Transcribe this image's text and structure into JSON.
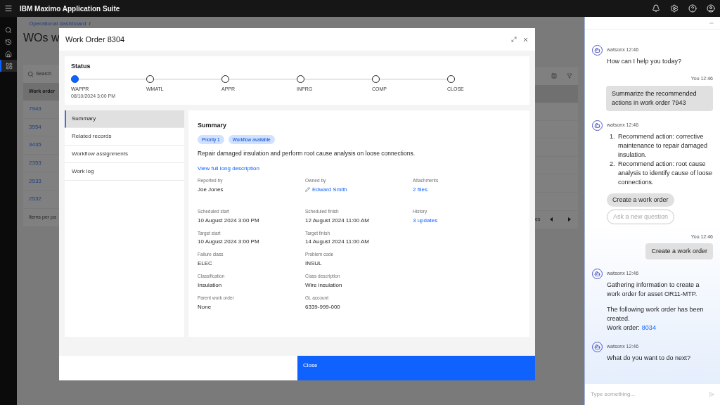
{
  "app_bar": {
    "title": "IBM Maximo Application Suite"
  },
  "side_rail": [
    {
      "selected": false
    },
    {
      "selected": false
    },
    {
      "selected": false
    },
    {
      "selected": true
    }
  ],
  "page": {
    "breadcrumb": "Operational dashboard",
    "breadcrumb_separator": "/",
    "title": "WOs w",
    "search_placeholder": "Search",
    "column_1": "Work order",
    "rows": [
      "7943",
      "3554",
      "3435",
      "2353",
      "2533",
      "2532"
    ],
    "footer_left": "Items per pa",
    "footer_right": "es"
  },
  "modal": {
    "title": "Work Order 8304",
    "status": {
      "title": "Status",
      "steps": [
        {
          "label": "WAPPR",
          "date": "08/10/2024 3:00 PM",
          "selected": true
        },
        {
          "label": "WMATL",
          "selected": false
        },
        {
          "label": "APPR",
          "selected": false
        },
        {
          "label": "INPRG",
          "selected": false
        },
        {
          "label": "COMP",
          "selected": false
        },
        {
          "label": "CLOSE",
          "selected": false
        }
      ]
    },
    "nav": [
      {
        "label": "Summary",
        "selected": true
      },
      {
        "label": "Related records",
        "selected": false
      },
      {
        "label": "Workflow assignments",
        "selected": false
      },
      {
        "label": "Work log",
        "selected": false
      }
    ],
    "summary": {
      "title": "Summary",
      "tags": [
        "Priority 1",
        "Workflow available"
      ],
      "description": "Repair damaged insulation and perform root cause analysis on loose connections.",
      "link": "View full long description",
      "rows": [
        [
          {
            "label": "Reported by",
            "value": "Joe Jones",
            "kind": "text"
          },
          {
            "label": "Owned by",
            "value": "Edward Smith",
            "kind": "owner"
          },
          {
            "label": "Attachments",
            "value": "2 files",
            "kind": "link"
          }
        ],
        [
          {
            "label": "Scheduled start",
            "value": "10 August 2024 3:00 PM",
            "kind": "text"
          },
          {
            "label": "Scheduled finish",
            "value": "12 August 2024 11:00 AM",
            "kind": "text"
          },
          {
            "label": "History",
            "value": "3 updates",
            "kind": "link"
          }
        ],
        [
          {
            "label": "Target start",
            "value": "10 August 2024 3:00 PM",
            "kind": "text"
          },
          {
            "label": "Target finish",
            "value": "14 August 2024 11:00 AM",
            "kind": "text"
          }
        ],
        [
          {
            "label": "Failure class",
            "value": "ELEC",
            "kind": "text"
          },
          {
            "label": "Problem code",
            "value": "INSUL",
            "kind": "text"
          }
        ],
        [
          {
            "label": "Classification",
            "value": "Insulation",
            "kind": "text"
          },
          {
            "label": "Class description",
            "value": "Wire insulation",
            "kind": "text"
          }
        ],
        [
          {
            "label": "Parent work order",
            "value": "None",
            "kind": "text"
          },
          {
            "label": "GL account",
            "value": "6339-999-000",
            "kind": "text"
          }
        ]
      ]
    },
    "close_button": "Close"
  },
  "chat": {
    "messages": [
      {
        "kind": "bot",
        "meta": "watsonx 12:46",
        "paragraphs": [
          {
            "text": "How can I help you today?"
          }
        ]
      },
      {
        "kind": "user",
        "meta": "You 12:46",
        "text": "Summarize the recommended actions in work order 7943"
      },
      {
        "kind": "bot",
        "meta": "watsonx 12:46",
        "list": [
          {
            "number": "1.",
            "text": "Recommend action: corrective maintenance to repair damaged insulation."
          },
          {
            "number": "2.",
            "text": "Recommend action: root cause analysis to identify cause of loose connections."
          }
        ],
        "chips": [
          {
            "label": "Create a work order",
            "disabled": false
          },
          {
            "label": "Ask a new question",
            "disabled": true
          }
        ]
      },
      {
        "kind": "user",
        "meta": "You 12:46",
        "text": "Create a work order"
      },
      {
        "kind": "bot",
        "meta": "watsonx 12:46",
        "paragraphs": [
          {
            "text": "Gathering information to create a work order for asset OR11-MTP."
          },
          {
            "text": "The following work order has been created."
          },
          {
            "text": "Work order:",
            "link": "8034"
          }
        ]
      },
      {
        "kind": "bot",
        "meta": "watsonx 12:46",
        "paragraphs": [
          {
            "text": "What do you want to do next?"
          }
        ]
      }
    ],
    "input_placeholder": "Type something..."
  }
}
